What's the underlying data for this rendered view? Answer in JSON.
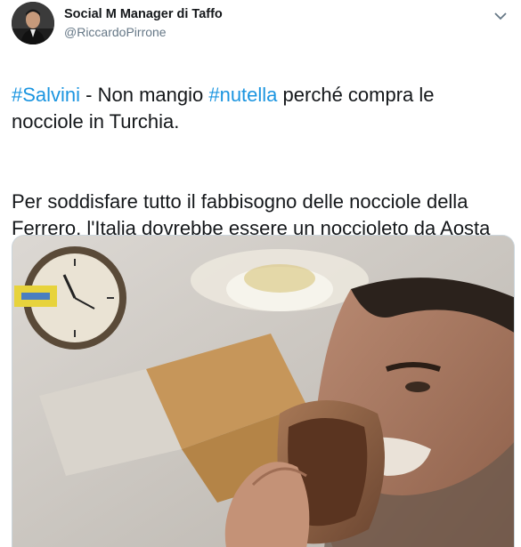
{
  "tweet": {
    "author": {
      "display_name": "Social M Manager di Taffo",
      "handle": "@RiccardoPirrone",
      "avatar_icon": "profile-photo-avatar"
    },
    "menu_icon": "chevron-down-icon",
    "text": {
      "p1": {
        "hashtag1": "#Salvini",
        "seg1": " - Non mangio ",
        "hashtag2": "#nutella",
        "seg2": " perché compra le nocciole in Turchia."
      },
      "p2": "Per soddisfare tutto il fabbisogno delle nocciole della Ferrero, l'Italia dovrebbe essere un noccioleto da Aosta fino a Marzamemi."
    },
    "media": {
      "image_icon": "selfie-photo-eating-bread-with-spread"
    },
    "colors": {
      "hashtag": "#1b95e0",
      "text": "#14171a",
      "secondary": "#657786",
      "border": "#ccd6dd"
    }
  }
}
